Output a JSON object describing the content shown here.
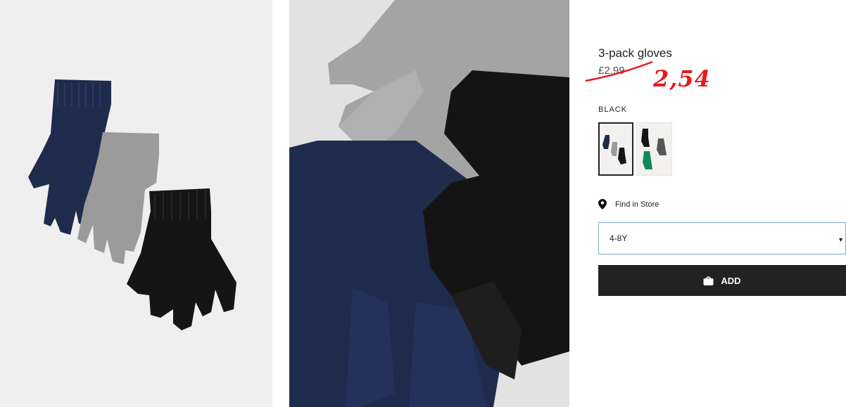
{
  "product": {
    "title": "3-pack gloves",
    "original_price": "£2.99",
    "annotated_price": "2,54",
    "color_label": "BLACK",
    "swatches": [
      {
        "name": "navy-grey-black",
        "selected": true
      },
      {
        "name": "black-grey-green",
        "selected": false
      }
    ],
    "find_in_store": "Find in Store",
    "size": {
      "selected": "4-8Y"
    },
    "add_label": "ADD"
  },
  "colors": {
    "navy": "#1f2b4d",
    "grey": "#9a9a9a",
    "black": "#151515",
    "green": "#0f8a5a",
    "annotation_red": "#e8191d",
    "button_bg": "#222222"
  },
  "icons": {
    "location": "map-pin-icon",
    "bag": "shopping-bag-icon",
    "caret": "caret-down-icon"
  }
}
